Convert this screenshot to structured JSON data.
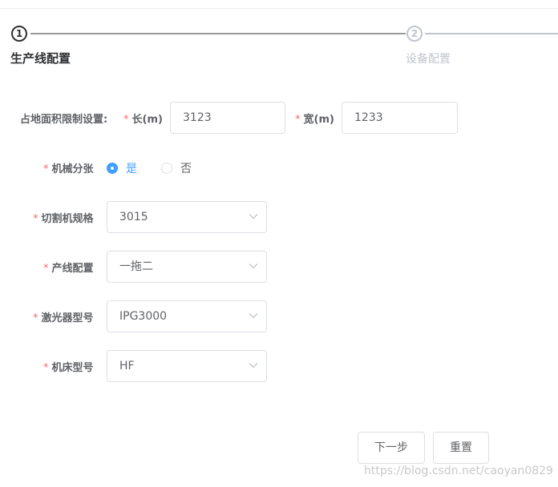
{
  "steps": [
    {
      "number": "1",
      "title": "生产线配置"
    },
    {
      "number": "2",
      "title": "设备配置"
    }
  ],
  "form": {
    "area_label": "占地面积限制设置:",
    "length_label": "长(m)",
    "length_value": "3123",
    "width_label": "宽(m)",
    "width_value": "1233",
    "split_label": "机械分张",
    "split_options": [
      {
        "label": "是",
        "selected": true
      },
      {
        "label": "否",
        "selected": false
      }
    ],
    "cutter_label": "切割机规格",
    "cutter_value": "3015",
    "line_label": "产线配置",
    "line_value": "一拖二",
    "laser_label": "激光器型号",
    "laser_value": "IPG3000",
    "bed_label": "机床型号",
    "bed_value": "HF",
    "required_mark": "*"
  },
  "buttons": {
    "next": "下一步",
    "reset": "重置"
  },
  "watermark": "https://blog.csdn.net/caoyan0829",
  "colors": {
    "primary": "#409eff",
    "required": "#f56c6c",
    "border": "#dcdfe6"
  }
}
